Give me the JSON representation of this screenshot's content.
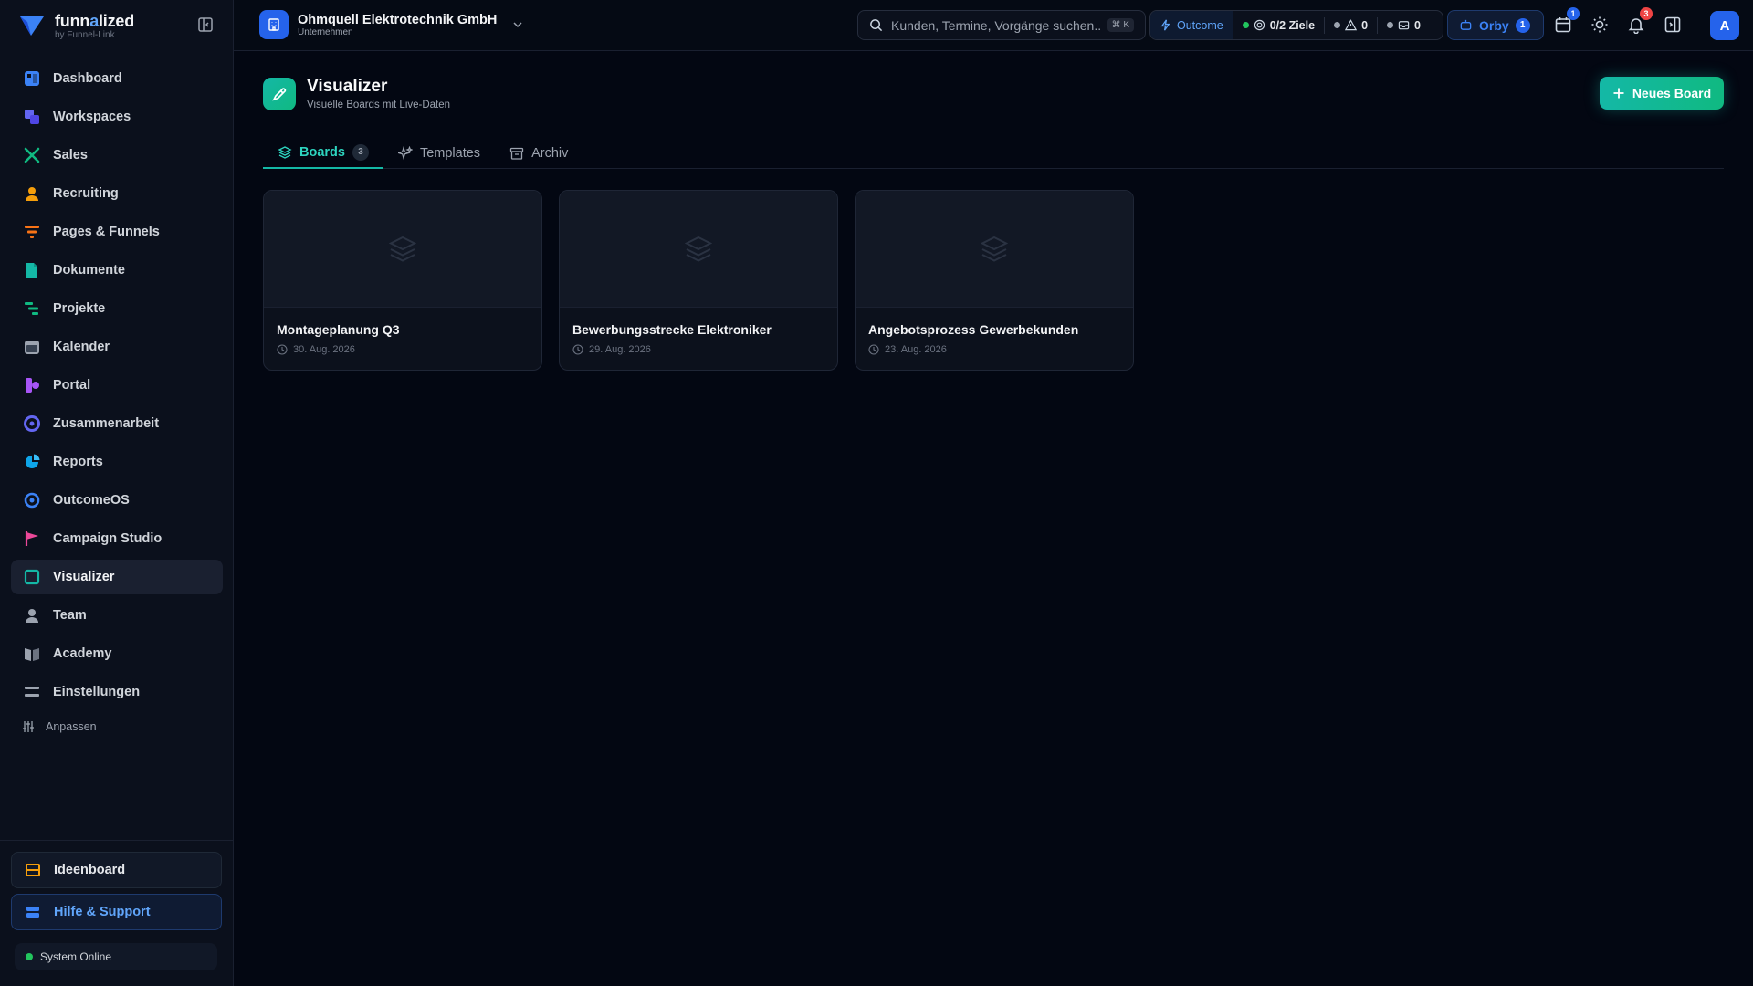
{
  "brand": {
    "name_start": "funn",
    "name_accent": "a",
    "name_end": "lized",
    "sub": "by Funnel-Link"
  },
  "nav": [
    {
      "label": "Dashboard",
      "icon": "dashboard-icon",
      "color": "#3b82f6"
    },
    {
      "label": "Workspaces",
      "icon": "workspaces-icon",
      "color": "#6366f1"
    },
    {
      "label": "Sales",
      "icon": "sales-icon",
      "color": "#10b981"
    },
    {
      "label": "Recruiting",
      "icon": "recruiting-icon",
      "color": "#f59e0b"
    },
    {
      "label": "Pages & Funnels",
      "icon": "funnel-icon",
      "color": "#f97316"
    },
    {
      "label": "Dokumente",
      "icon": "documents-icon",
      "color": "#14b8a6"
    },
    {
      "label": "Projekte",
      "icon": "projects-icon",
      "color": "#10b981"
    },
    {
      "label": "Kalender",
      "icon": "calendar-icon",
      "color": "#9ca3af"
    },
    {
      "label": "Portal",
      "icon": "portal-icon",
      "color": "#a855f7"
    },
    {
      "label": "Zusammenarbeit",
      "icon": "collaboration-icon",
      "color": "#6366f1"
    },
    {
      "label": "Reports",
      "icon": "reports-icon",
      "color": "#0ea5e9"
    },
    {
      "label": "OutcomeOS",
      "icon": "outcome-icon",
      "color": "#3b82f6"
    },
    {
      "label": "Campaign Studio",
      "icon": "flag-icon",
      "color": "#ec4899"
    },
    {
      "label": "Visualizer",
      "icon": "visualizer-icon",
      "color": "#14b8a6",
      "active": true
    },
    {
      "label": "Team",
      "icon": "team-icon",
      "color": "#9ca3af"
    },
    {
      "label": "Academy",
      "icon": "academy-icon",
      "color": "#9ca3af"
    },
    {
      "label": "Einstellungen",
      "icon": "settings-icon",
      "color": "#9ca3af"
    }
  ],
  "customize_label": "Anpassen",
  "ideenboard_label": "Ideenboard",
  "support_label": "Hilfe & Support",
  "system_status": "System Online",
  "company": {
    "name": "Ohmquell Elektrotechnik GmbH",
    "type": "Unternehmen"
  },
  "search": {
    "placeholder": "Kunden, Termine, Vorgänge suchen...",
    "shortcut": "⌘ K"
  },
  "outcome": {
    "label": "Outcome",
    "goals": "0/2 Ziele",
    "warnings": "0",
    "messages": "0"
  },
  "orby": {
    "label": "Orby",
    "count": "1"
  },
  "topbar_badges": {
    "calendar": "1",
    "notifications": "3"
  },
  "avatar_initial": "A",
  "page": {
    "title": "Visualizer",
    "subtitle": "Visuelle Boards mit Live-Daten",
    "new_button": "Neues Board"
  },
  "tabs": [
    {
      "label": "Boards",
      "count": "3",
      "active": true
    },
    {
      "label": "Templates"
    },
    {
      "label": "Archiv"
    }
  ],
  "boards": [
    {
      "title": "Montageplanung Q3",
      "date": "30. Aug. 2026"
    },
    {
      "title": "Bewerbungsstrecke Elektroniker",
      "date": "29. Aug. 2026"
    },
    {
      "title": "Angebotsprozess Gewerbekunden",
      "date": "23. Aug. 2026"
    }
  ],
  "colors": {
    "accent": "#14b8a6",
    "brand_blue": "#2563eb",
    "background": "#030712"
  }
}
